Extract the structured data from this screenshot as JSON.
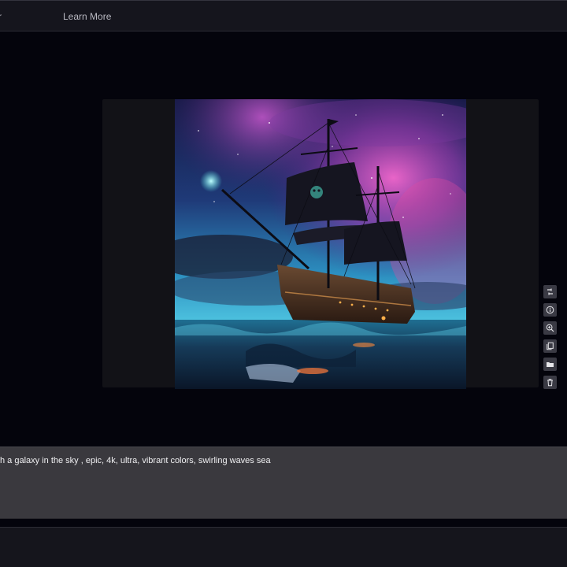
{
  "nav": {
    "cut_item_label": "r",
    "learn_more_label": "Learn More"
  },
  "image": {
    "subject": "pirate ship sailing at night under a galaxy sky"
  },
  "toolbar": {
    "icons": [
      "adjust-icon",
      "info-icon",
      "zoom-in-icon",
      "copy-icon",
      "folder-icon",
      "trash-icon"
    ]
  },
  "prompt": {
    "text": "h a galaxy in the sky , epic, 4k, ultra, vibrant colors, swirling waves sea"
  },
  "colors": {
    "background": "#04040c",
    "bar": "#15151d",
    "prompt_bg": "#3a393e",
    "tool_button": "#3a3a44"
  }
}
